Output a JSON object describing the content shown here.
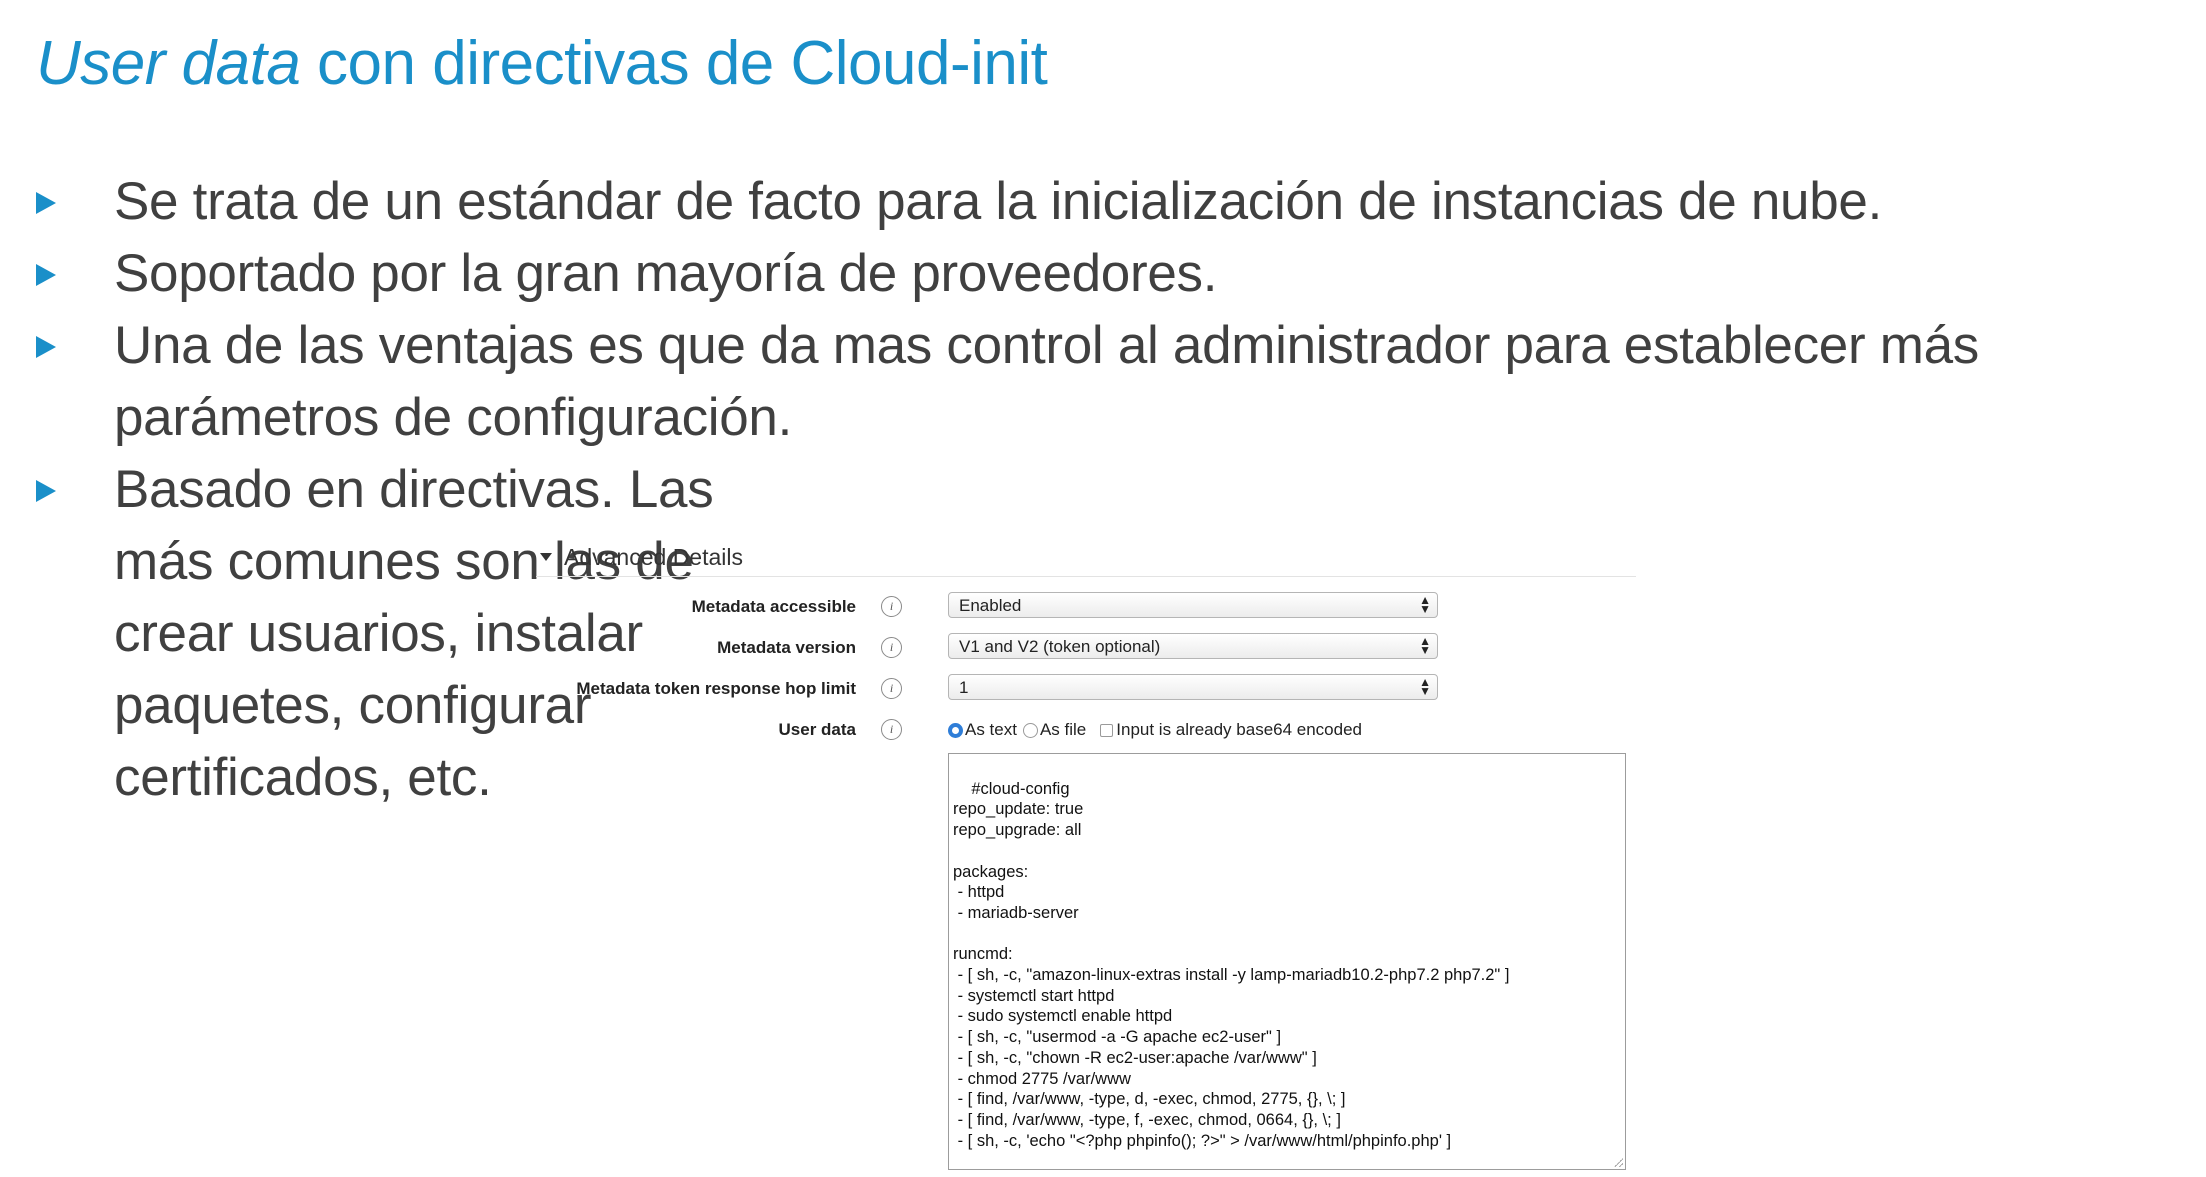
{
  "title": {
    "emphasis": "User data",
    "rest": " con directivas de Cloud-init"
  },
  "bullets": [
    "Se trata de un estándar de facto para la inicialización de instancias de nube.",
    "Soportado por la gran mayoría de proveedores.",
    "Una de las ventajas es que da mas control al administrador para establecer más parámetros de configuración.",
    "Basado en directivas. Las más comunes son las de crear usuarios, instalar paquetes, configurar certificados, etc."
  ],
  "colors": {
    "accent": "#1a8fc9",
    "body_text": "#404040"
  },
  "panel": {
    "header": "Advanced Details",
    "metadata_accessible": {
      "label": "Metadata accessible",
      "value": "Enabled"
    },
    "metadata_version": {
      "label": "Metadata version",
      "value": "V1 and V2 (token optional)"
    },
    "hop_limit": {
      "label": "Metadata token response hop limit",
      "value": "1"
    },
    "user_data": {
      "label": "User data",
      "option_text": "As text",
      "option_file": "As file",
      "base64_label": "Input is already base64 encoded",
      "selected": "As text",
      "content": "#cloud-config\nrepo_update: true\nrepo_upgrade: all\n\npackages:\n - httpd\n - mariadb-server\n\nruncmd:\n - [ sh, -c, \"amazon-linux-extras install -y lamp-mariadb10.2-php7.2 php7.2\" ]\n - systemctl start httpd\n - sudo systemctl enable httpd\n - [ sh, -c, \"usermod -a -G apache ec2-user\" ]\n - [ sh, -c, \"chown -R ec2-user:apache /var/www\" ]\n - chmod 2775 /var/www\n - [ find, /var/www, -type, d, -exec, chmod, 2775, {}, \\; ]\n - [ find, /var/www, -type, f, -exec, chmod, 0664, {}, \\; ]\n - [ sh, -c, 'echo \"<?php phpinfo(); ?>\" > /var/www/html/phpinfo.php' ]"
    },
    "info_icon_glyph": "i"
  }
}
